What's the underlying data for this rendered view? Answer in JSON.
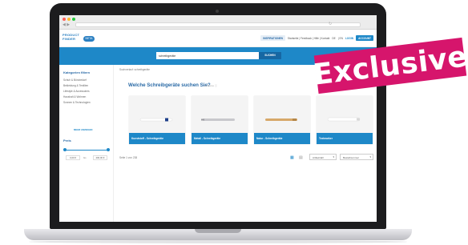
{
  "app": {
    "logo_line1": "PRODUCT",
    "logo_line2": "FINDER",
    "beta": "BETA"
  },
  "top_nav": {
    "inspiration": "INSPIRATIONEN",
    "links": "Startseite | Feedback | Hilfe | Kontakt",
    "lang": "DE",
    "currency": "| EN",
    "login": "LOGIN",
    "account_button": "ACCOUNT"
  },
  "search": {
    "value": "schreibgeräte",
    "button": "SUCHEN"
  },
  "sidebar": {
    "title": "Kategorien filtern",
    "items": [
      "Schuh & Bürobedarf",
      "Bekleidung & Textilien",
      "Lifestyle & Accessoires",
      "Haushalt & Wohnen",
      "Sonnen & Technologien"
    ],
    "show_more": "MEHR ANZEIGEN",
    "price_title": "Preis",
    "price_from": "0,00 €",
    "price_to": "400,00 €",
    "price_sep": "bis"
  },
  "main": {
    "breadcrumb": "Suchverlauf: schreibgeräte",
    "title": "Welche Schreibgeräte suchen Sie?",
    "help": "Hinweise ⓘ",
    "categories": [
      {
        "label": "Kunststoff - Schreibgeräte",
        "pen_color": "#ffffff",
        "accent": "#1e3f8a"
      },
      {
        "label": "Metall - Schreibgeräte",
        "pen_color": "#c8c8cc",
        "accent": "#9a9aa0"
      },
      {
        "label": "Natur - Schreibgeräte",
        "pen_color": "#d7a869",
        "accent": "#b48648"
      },
      {
        "label": "Textmarker",
        "pen_color": "#ffffff",
        "accent": "#d8d8d8"
      }
    ],
    "hit_count": "Seite 1 von 238",
    "sort_select": "Artikelzahl",
    "sort_order_select": "Bestellnummer"
  },
  "badge": {
    "text": "Exclusive",
    "color": "#d6156c"
  }
}
